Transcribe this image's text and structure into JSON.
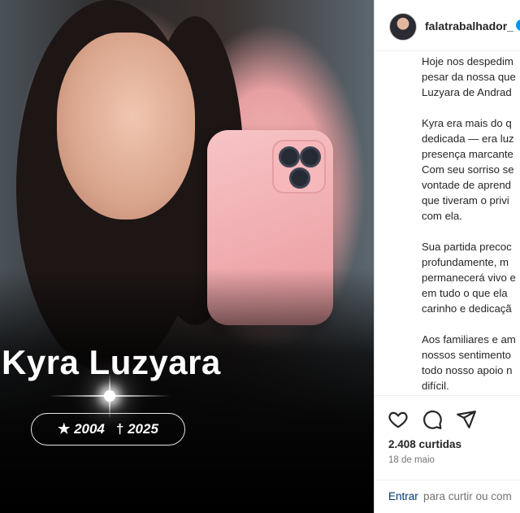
{
  "post": {
    "name_overlay": "Kyra Luzyara",
    "birth_year": "2004",
    "death_year": "2025",
    "birth_symbol": "★",
    "death_symbol": "†"
  },
  "header": {
    "username": "falatrabalhador_"
  },
  "caption": {
    "lines": [
      "Hoje nos despedim",
      "pesar da nossa que",
      "Luzyara de Andrad",
      "",
      "Kyra era mais do q",
      "dedicada — era luz",
      "presença marcante",
      "Com seu sorriso se",
      "vontade de aprend",
      "que tiveram o privi",
      "com ela.",
      "",
      "Sua partida precoc",
      "profundamente, m",
      "permanecerá vivo e",
      "em tudo o que ela",
      "carinho e dedicaçã",
      "",
      "Aos familiares e am",
      "nossos sentimento",
      "todo nosso apoio n",
      "difícil."
    ]
  },
  "stats": {
    "likes": "2.408 curtidas",
    "date": "18 de maio"
  },
  "footer": {
    "login_link": "Entrar",
    "login_rest": "para curtir ou com"
  },
  "icons": {
    "like": "heart-icon",
    "comment": "comment-icon",
    "share": "send-icon",
    "verified": "verified-badge-icon"
  },
  "colors": {
    "link": "#00376b",
    "verified": "#0095f6",
    "text": "#262626",
    "muted": "#737373"
  }
}
